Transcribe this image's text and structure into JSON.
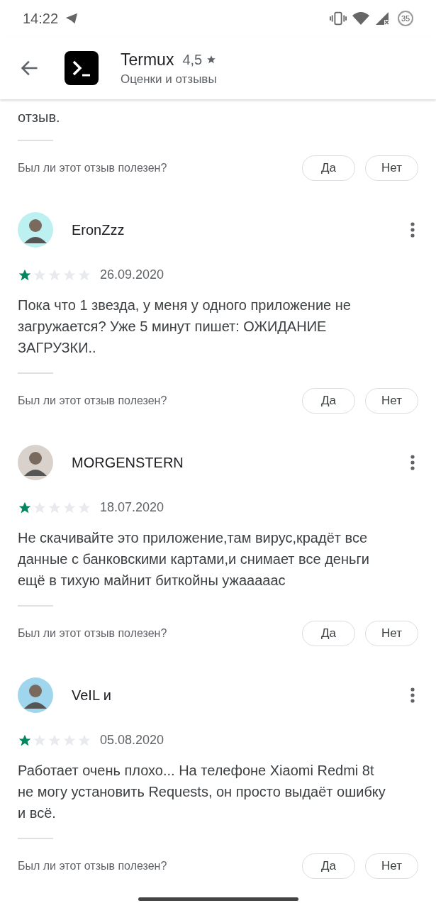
{
  "status_bar": {
    "time": "14:22",
    "battery": "35"
  },
  "header": {
    "app_name": "Termux",
    "rating": "4,5",
    "subtitle": "Оценки и отзывы"
  },
  "partial_review": {
    "text": "отзыв.",
    "helpful_question": "Был ли этот отзыв полезен?",
    "yes": "Да",
    "no": "Нет"
  },
  "reviews": [
    {
      "author": "EronZzz",
      "color": "#bdf0f0",
      "stars": 1,
      "date": "26.09.2020",
      "text": "Пока что 1 звезда, у меня у одного приложение не загружается? Уже 5 минут пишет: ОЖИДАНИЕ ЗАГРУЗКИ..",
      "helpful_question": "Был ли этот отзыв полезен?",
      "yes": "Да",
      "no": "Нет"
    },
    {
      "author": "MORGENSTERN",
      "color": "#d9d2cc",
      "stars": 1,
      "date": "18.07.2020",
      "text": "Не скачивайте это приложение,там вирус,крадёт все данные с банковскими картами,и снимает все деньги ещё в тихую майнит биткойны ужааааас",
      "helpful_question": "Был ли этот отзыв полезен?",
      "yes": "Да",
      "no": "Нет"
    },
    {
      "author": "VeIL и",
      "color": "#9fd6ee",
      "stars": 1,
      "date": "05.08.2020",
      "text": "Работает очень плохо... На телефоне Xiaomi Redmi 8t не могу установить Requests, он просто выдаёт ошибку и всё.",
      "helpful_question": "Был ли этот отзыв полезен?",
      "yes": "Да",
      "no": "Нет"
    }
  ]
}
